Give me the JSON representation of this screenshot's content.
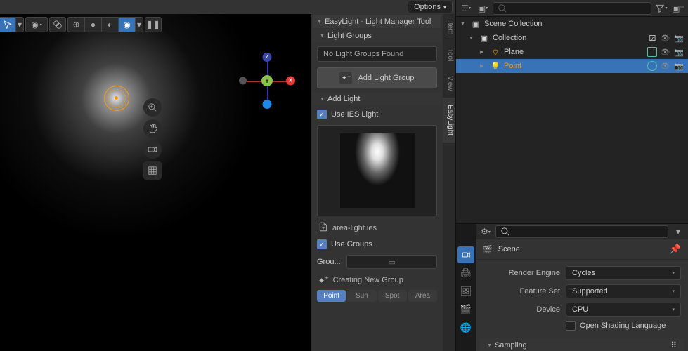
{
  "header": {
    "options_label": "Options"
  },
  "gizmo": {
    "x": "X",
    "y": "Y",
    "z": "Z"
  },
  "viewport_header": {
    "view_icon": "view-icon",
    "cursor_icon": "cursor-icon",
    "sphere_icon": "sphere-icon",
    "overlay_icon": "overlay-icon",
    "shading": [
      "wire",
      "solid",
      "matcap",
      "render"
    ]
  },
  "n_panel": {
    "title": "EasyLight - Light Manager Tool",
    "tabs": {
      "item": "Item",
      "tool": "Tool",
      "view": "View",
      "easylight": "EasyLight"
    },
    "light_groups": {
      "header": "Light Groups",
      "empty_msg": "No Light Groups Found",
      "add_btn": "Add Light Group"
    },
    "add_light": {
      "header": "Add Light",
      "use_ies": "Use IES Light",
      "file": "area-light.ies",
      "use_groups": "Use Groups",
      "group_label": "Grou...",
      "creating": "Creating New Group",
      "types": {
        "point": "Point",
        "sun": "Sun",
        "spot": "Spot",
        "area": "Area"
      }
    }
  },
  "outliner": {
    "scene_collection": "Scene Collection",
    "collection": "Collection",
    "plane": "Plane",
    "point": "Point"
  },
  "properties": {
    "scene_label": "Scene",
    "render_engine": {
      "label": "Render Engine",
      "value": "Cycles"
    },
    "feature_set": {
      "label": "Feature Set",
      "value": "Supported"
    },
    "device": {
      "label": "Device",
      "value": "CPU"
    },
    "osl": "Open Shading Language",
    "sampling": "Sampling"
  }
}
